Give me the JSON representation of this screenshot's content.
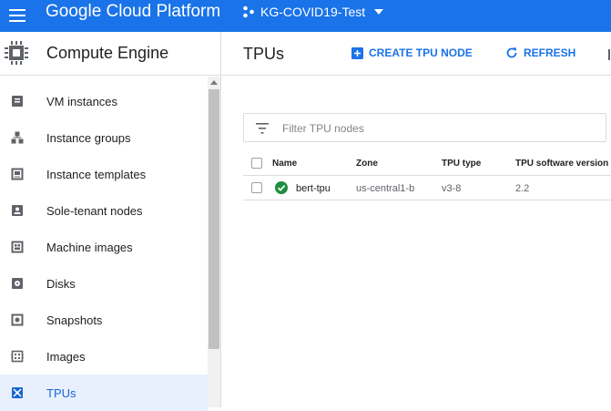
{
  "topbar": {
    "brand": "Google Cloud Platform",
    "project": "KG-COVID19-Test",
    "color": "#1a73e8"
  },
  "sidebar": {
    "title": "Compute Engine",
    "items": [
      {
        "label": "VM instances",
        "icon": "vm-instances-icon"
      },
      {
        "label": "Instance groups",
        "icon": "instance-groups-icon"
      },
      {
        "label": "Instance templates",
        "icon": "instance-templates-icon"
      },
      {
        "label": "Sole-tenant nodes",
        "icon": "sole-tenant-nodes-icon"
      },
      {
        "label": "Machine images",
        "icon": "machine-images-icon"
      },
      {
        "label": "Disks",
        "icon": "disks-icon"
      },
      {
        "label": "Snapshots",
        "icon": "snapshots-icon"
      },
      {
        "label": "Images",
        "icon": "images-icon"
      },
      {
        "label": "TPUs",
        "icon": "tpus-icon",
        "active": true
      }
    ],
    "active_color": "#1967d2",
    "active_bg": "#e8f0fe"
  },
  "main": {
    "title": "TPUs",
    "actions": {
      "create": "CREATE TPU NODE",
      "refresh": "REFRESH"
    },
    "filter": {
      "placeholder": "Filter TPU nodes",
      "value": ""
    },
    "table": {
      "columns": [
        "Name",
        "Zone",
        "TPU type",
        "TPU software version"
      ],
      "rows": [
        {
          "status": "running",
          "name": "bert-tpu",
          "zone": "us-central1-b",
          "type": "v3-8",
          "version": "2.2"
        }
      ]
    },
    "status_color": "#1e8e3e"
  }
}
